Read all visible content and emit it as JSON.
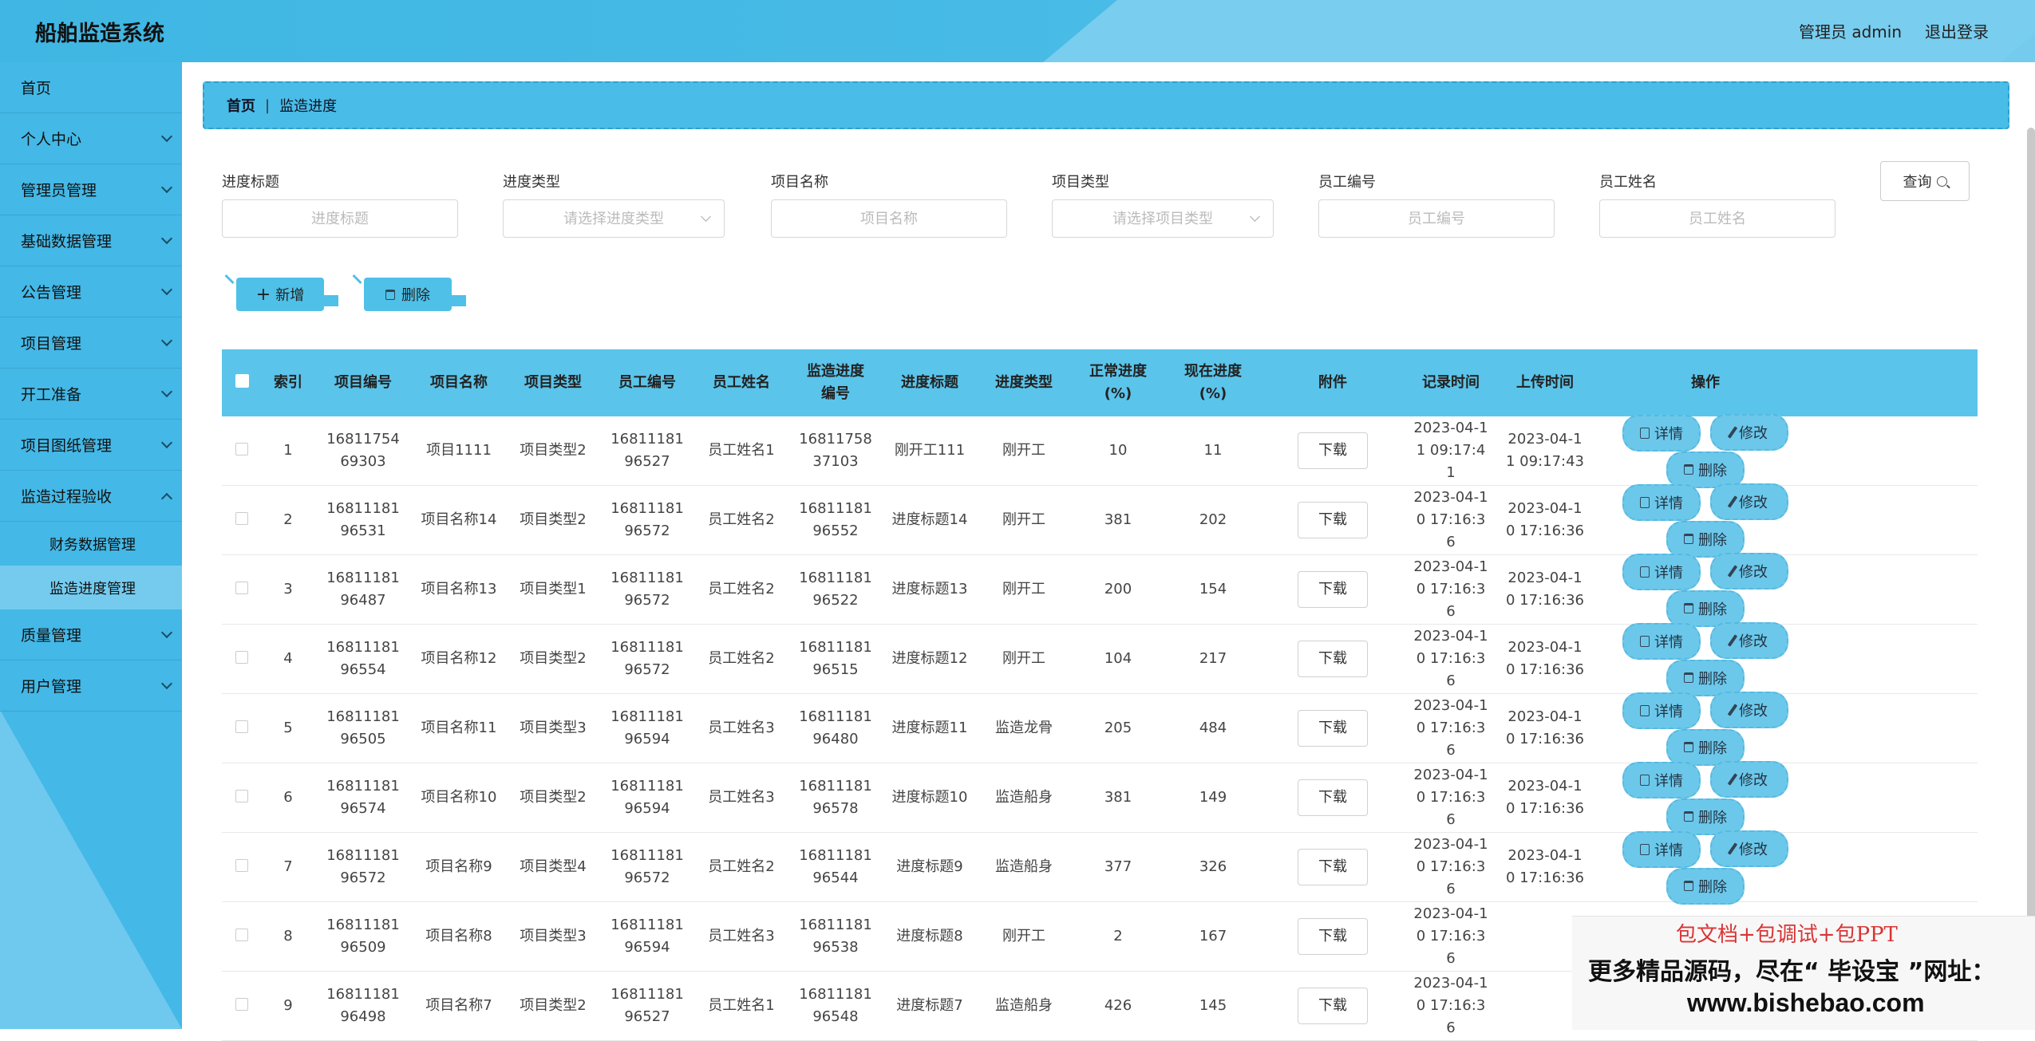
{
  "app": {
    "title": "船舶监造系统"
  },
  "header": {
    "user": "管理员 admin",
    "logout": "退出登录"
  },
  "sidebar": {
    "items": [
      {
        "label": "首页",
        "chevron": false
      },
      {
        "label": "个人中心",
        "chevron": true
      },
      {
        "label": "管理员管理",
        "chevron": true
      },
      {
        "label": "基础数据管理",
        "chevron": true
      },
      {
        "label": "公告管理",
        "chevron": true
      },
      {
        "label": "项目管理",
        "chevron": true
      },
      {
        "label": "开工准备",
        "chevron": true
      },
      {
        "label": "项目图纸管理",
        "chevron": true
      },
      {
        "label": "监造过程验收",
        "chevron": "up"
      },
      {
        "label": "质量管理",
        "chevron": true
      },
      {
        "label": "用户管理",
        "chevron": true
      }
    ],
    "subitems": [
      {
        "label": "财务数据管理",
        "active": false
      },
      {
        "label": "监造进度管理",
        "active": true
      }
    ]
  },
  "breadcrumb": {
    "home": "首页",
    "sep": "|",
    "current": "监造进度"
  },
  "search": {
    "fields": [
      {
        "label": "进度标题",
        "placeholder": "进度标题",
        "type": "input"
      },
      {
        "label": "进度类型",
        "placeholder": "请选择进度类型",
        "type": "select"
      },
      {
        "label": "项目名称",
        "placeholder": "项目名称",
        "type": "input"
      },
      {
        "label": "项目类型",
        "placeholder": "请选择项目类型",
        "type": "select"
      },
      {
        "label": "员工编号",
        "placeholder": "员工编号",
        "type": "input"
      },
      {
        "label": "员工姓名",
        "placeholder": "员工姓名",
        "type": "input"
      }
    ],
    "query": "查询"
  },
  "actions": {
    "add": "新增",
    "delete": "删除"
  },
  "table": {
    "headers": [
      "索引",
      "项目编号",
      "项目名称",
      "项目类型",
      "员工编号",
      "员工姓名",
      "监造进度编号",
      "进度标题",
      "进度类型",
      "正常进度(%)",
      "现在进度(%)",
      "附件",
      "记录时间",
      "上传时间",
      "操作"
    ],
    "download": "下载",
    "ops": {
      "detail": "详情",
      "edit": "修改",
      "delete": "删除"
    },
    "rows": [
      {
        "idx": "1",
        "pno": "1681175469303",
        "pname": "项目1111",
        "ptype": "项目类型2",
        "eno": "1681118196527",
        "ename": "员工姓名1",
        "sno": "1681175837103",
        "title": "刚开工111",
        "stype": "刚开工",
        "normal": "10",
        "now": "11",
        "rec": "2023-04-11 09:17:41",
        "up": "2023-04-11 09:17:43"
      },
      {
        "idx": "2",
        "pno": "1681118196531",
        "pname": "项目名称14",
        "ptype": "项目类型2",
        "eno": "1681118196572",
        "ename": "员工姓名2",
        "sno": "1681118196552",
        "title": "进度标题14",
        "stype": "刚开工",
        "normal": "381",
        "now": "202",
        "rec": "2023-04-10 17:16:36",
        "up": "2023-04-10 17:16:36"
      },
      {
        "idx": "3",
        "pno": "1681118196487",
        "pname": "项目名称13",
        "ptype": "项目类型1",
        "eno": "1681118196572",
        "ename": "员工姓名2",
        "sno": "1681118196522",
        "title": "进度标题13",
        "stype": "刚开工",
        "normal": "200",
        "now": "154",
        "rec": "2023-04-10 17:16:36",
        "up": "2023-04-10 17:16:36"
      },
      {
        "idx": "4",
        "pno": "1681118196554",
        "pname": "项目名称12",
        "ptype": "项目类型2",
        "eno": "1681118196572",
        "ename": "员工姓名2",
        "sno": "1681118196515",
        "title": "进度标题12",
        "stype": "刚开工",
        "normal": "104",
        "now": "217",
        "rec": "2023-04-10 17:16:36",
        "up": "2023-04-10 17:16:36"
      },
      {
        "idx": "5",
        "pno": "1681118196505",
        "pname": "项目名称11",
        "ptype": "项目类型3",
        "eno": "1681118196594",
        "ename": "员工姓名3",
        "sno": "1681118196480",
        "title": "进度标题11",
        "stype": "监造龙骨",
        "normal": "205",
        "now": "484",
        "rec": "2023-04-10 17:16:36",
        "up": "2023-04-10 17:16:36"
      },
      {
        "idx": "6",
        "pno": "1681118196574",
        "pname": "项目名称10",
        "ptype": "项目类型2",
        "eno": "1681118196594",
        "ename": "员工姓名3",
        "sno": "1681118196578",
        "title": "进度标题10",
        "stype": "监造船身",
        "normal": "381",
        "now": "149",
        "rec": "2023-04-10 17:16:36",
        "up": "2023-04-10 17:16:36"
      },
      {
        "idx": "7",
        "pno": "1681118196572",
        "pname": "项目名称9",
        "ptype": "项目类型4",
        "eno": "1681118196572",
        "ename": "员工姓名2",
        "sno": "1681118196544",
        "title": "进度标题9",
        "stype": "监造船身",
        "normal": "377",
        "now": "326",
        "rec": "2023-04-10 17:16:36",
        "up": "2023-04-10 17:16:36"
      },
      {
        "idx": "8",
        "pno": "1681118196509",
        "pname": "项目名称8",
        "ptype": "项目类型3",
        "eno": "1681118196594",
        "ename": "员工姓名3",
        "sno": "1681118196538",
        "title": "进度标题8",
        "stype": "刚开工",
        "normal": "2",
        "now": "167",
        "rec": "2023-04-10 17:16:36",
        "up": ""
      },
      {
        "idx": "9",
        "pno": "1681118196498",
        "pname": "项目名称7",
        "ptype": "项目类型2",
        "eno": "1681118196527",
        "ename": "员工姓名1",
        "sno": "1681118196548",
        "title": "进度标题7",
        "stype": "监造船身",
        "normal": "426",
        "now": "145",
        "rec": "2023-04-10 17:16:36",
        "up": ""
      }
    ]
  },
  "ad": {
    "line1": "包文档+包调试+包PPT",
    "line2": "更多精品源码，尽在“ 毕设宝 ”网址：",
    "line3": "www.bishebao.com"
  }
}
